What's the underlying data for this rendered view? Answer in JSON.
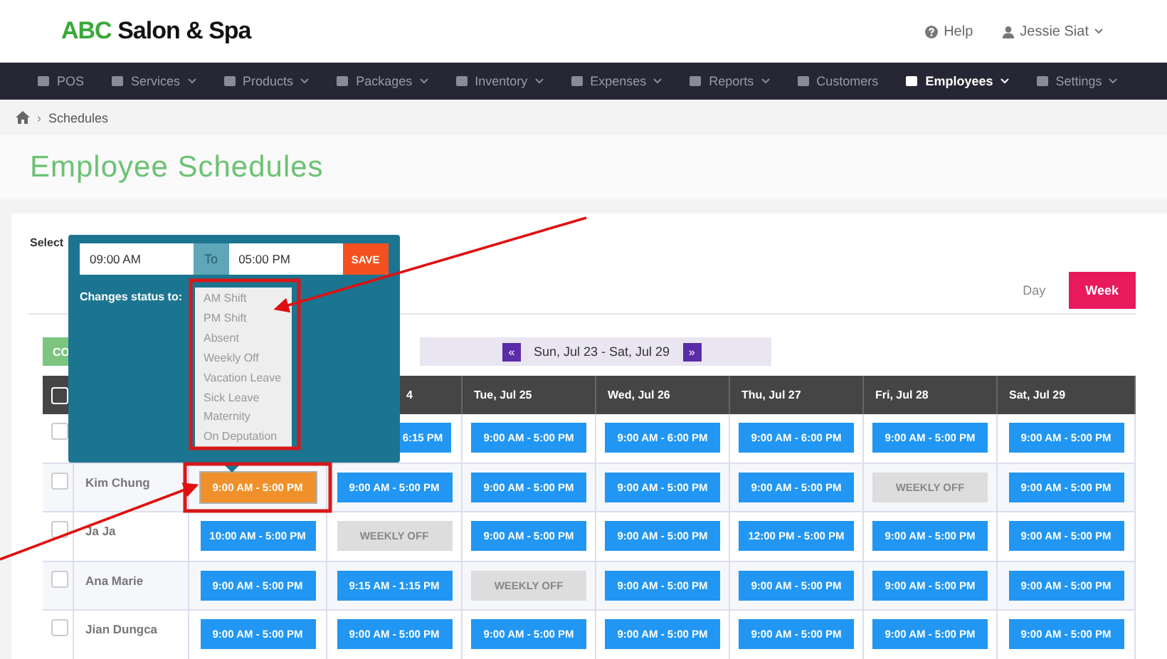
{
  "brand": {
    "accent": "ABC",
    "name": "Salon & Spa"
  },
  "header_links": [
    {
      "kind": "help",
      "label": "Help",
      "has_menu": false
    },
    {
      "kind": "user",
      "label": "Jessie Siat",
      "has_menu": true
    }
  ],
  "nav": [
    {
      "label": "POS",
      "has_menu": false,
      "selected": false
    },
    {
      "label": "Services",
      "has_menu": true,
      "selected": false
    },
    {
      "label": "Products",
      "has_menu": true,
      "selected": false
    },
    {
      "label": "Packages",
      "has_menu": true,
      "selected": false
    },
    {
      "label": "Inventory",
      "has_menu": true,
      "selected": false
    },
    {
      "label": "Expenses",
      "has_menu": true,
      "selected": false
    },
    {
      "label": "Reports",
      "has_menu": true,
      "selected": false
    },
    {
      "label": "Customers",
      "has_menu": false,
      "selected": false
    },
    {
      "label": "Employees",
      "has_menu": true,
      "selected": true
    },
    {
      "label": "Settings",
      "has_menu": true,
      "selected": false
    }
  ],
  "breadcrumb": {
    "separator": "›",
    "current": "Schedules"
  },
  "page_title": "Employee Schedules",
  "select_label": "Select",
  "view_tabs": [
    {
      "label": "Day",
      "selected": false
    },
    {
      "label": "Week",
      "selected": true
    }
  ],
  "copy_button": "CO",
  "week_nav": {
    "prev": "«",
    "range": "Sun, Jul 23 - Sat, Jul 29",
    "next": "»"
  },
  "table": {
    "header_checkbox": {
      "checked": false
    },
    "columns": [
      {
        "kind": "hidden"
      },
      {
        "label": "4",
        "kind": "partial"
      },
      {
        "label": "Tue, Jul 25",
        "kind": "day"
      },
      {
        "label": "Wed, Jul 26",
        "kind": "day"
      },
      {
        "label": "Thu, Jul 27",
        "kind": "day"
      },
      {
        "label": "Fri, Jul 28",
        "kind": "day"
      },
      {
        "label": "Sat, Jul 29",
        "kind": "day"
      }
    ],
    "rows": [
      {
        "checked": false,
        "cells": [
          {
            "kind": "hidden"
          },
          {
            "kind": "partial",
            "text": "6:15 PM"
          },
          {
            "kind": "shift",
            "text": "9:00 AM - 5:00 PM"
          },
          {
            "kind": "shift",
            "text": "9:00 AM - 6:00 PM"
          },
          {
            "kind": "shift",
            "text": "9:00 AM - 6:00 PM"
          },
          {
            "kind": "shift",
            "text": "9:00 AM - 5:00 PM"
          },
          {
            "kind": "shift",
            "text": "9:00 AM - 5:00 PM"
          }
        ]
      },
      {
        "name": "Kim Chung",
        "checked": false,
        "cells": [
          {
            "kind": "selected",
            "text": "9:00 AM - 5:00 PM"
          },
          {
            "kind": "shift",
            "text": "9:00 AM - 5:00 PM"
          },
          {
            "kind": "shift",
            "text": "9:00 AM - 5:00 PM"
          },
          {
            "kind": "shift",
            "text": "9:00 AM - 5:00 PM"
          },
          {
            "kind": "shift",
            "text": "9:00 AM - 5:00 PM"
          },
          {
            "kind": "off",
            "text": "WEEKLY OFF"
          },
          {
            "kind": "shift",
            "text": "9:00 AM - 5:00 PM"
          }
        ]
      },
      {
        "name": "Ja Ja",
        "checked": false,
        "cells": [
          {
            "kind": "shift",
            "text": "10:00 AM - 5:00 PM"
          },
          {
            "kind": "off",
            "text": "WEEKLY OFF"
          },
          {
            "kind": "shift",
            "text": "9:00 AM - 5:00 PM"
          },
          {
            "kind": "shift",
            "text": "9:00 AM - 5:00 PM"
          },
          {
            "kind": "shift",
            "text": "12:00 PM - 5:00 PM"
          },
          {
            "kind": "shift",
            "text": "9:00 AM - 5:00 PM"
          },
          {
            "kind": "shift",
            "text": "9:00 AM - 5:00 PM"
          }
        ]
      },
      {
        "name": "Ana Marie",
        "checked": false,
        "cells": [
          {
            "kind": "shift",
            "text": "9:00 AM - 5:00 PM"
          },
          {
            "kind": "shift",
            "text": "9:15 AM - 1:15 PM"
          },
          {
            "kind": "off",
            "text": "WEEKLY OFF"
          },
          {
            "kind": "shift",
            "text": "9:00 AM - 5:00 PM"
          },
          {
            "kind": "shift",
            "text": "9:00 AM - 5:00 PM"
          },
          {
            "kind": "shift",
            "text": "9:00 AM - 5:00 PM"
          },
          {
            "kind": "shift",
            "text": "9:00 AM - 5:00 PM"
          }
        ]
      },
      {
        "name": "Jian Dungca",
        "checked": false,
        "cells": [
          {
            "kind": "shift",
            "text": "9:00 AM - 5:00 PM"
          },
          {
            "kind": "shift",
            "text": "9:00 AM - 5:00 PM"
          },
          {
            "kind": "shift",
            "text": "9:00 AM - 5:00 PM"
          },
          {
            "kind": "shift",
            "text": "9:00 AM - 5:00 PM"
          },
          {
            "kind": "shift",
            "text": "9:00 AM - 5:00 PM"
          },
          {
            "kind": "shift",
            "text": "9:00 AM - 5:00 PM"
          },
          {
            "kind": "shift",
            "text": "9:00 AM - 5:00 PM"
          }
        ]
      }
    ]
  },
  "popup": {
    "from": "09:00 AM",
    "to_label": "To",
    "to": "05:00 PM",
    "save": "SAVE",
    "status_label": "Changes status to:",
    "options": [
      "AM Shift",
      "PM Shift",
      "Absent",
      "Weekly Off",
      "Vacation Leave",
      "Sick Leave",
      "Maternity",
      "On Deputation"
    ]
  }
}
